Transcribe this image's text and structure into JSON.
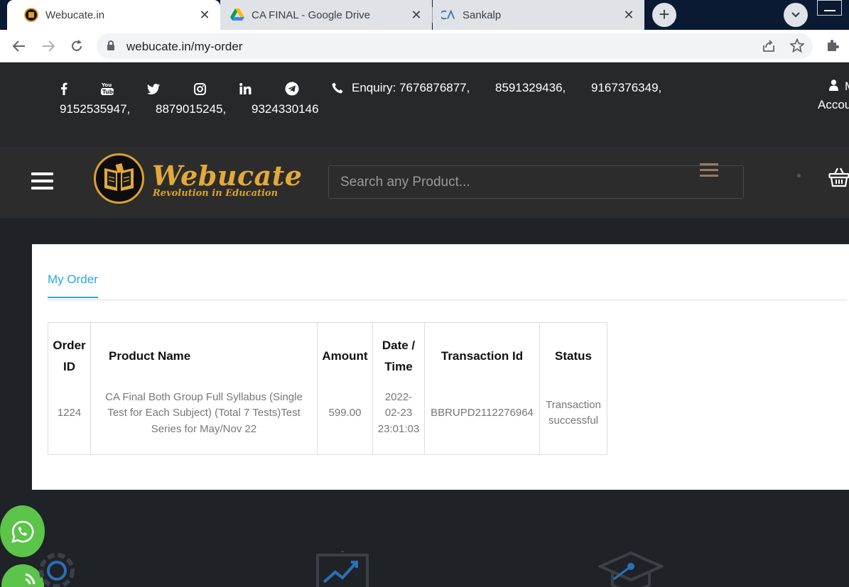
{
  "browser": {
    "tabs": [
      {
        "title": "Webucate.in",
        "active": true
      },
      {
        "title": "CA FINAL - Google Drive",
        "active": false
      },
      {
        "title": "Sankalp",
        "active": false
      }
    ],
    "url": "webucate.in/my-order"
  },
  "topbar": {
    "enquiry_line1": "Enquiry: 7676876877,",
    "phone2": "8591329436,",
    "phone3": "9167376349,",
    "phone4": "9152535947,",
    "phone5": "8879015245,",
    "phone6": "9324330146",
    "account_m": "M",
    "account_label": "Accou",
    "social_icons": [
      "facebook-icon",
      "youtube-icon",
      "twitter-icon",
      "instagram-icon",
      "linkedin-icon",
      "telegram-icon"
    ]
  },
  "header": {
    "logo_text": "Webucate",
    "logo_tagline": "Revolution in Education",
    "search_placeholder": "Search any Product..."
  },
  "orders": {
    "tab_label": "My Order",
    "columns": [
      "Order ID",
      "Product Name",
      "Amount",
      "Date / Time",
      "Transaction Id",
      "Status"
    ],
    "rows": [
      {
        "order_id": "1224",
        "product_name": "CA Final Both Group Full Syllabus (Single Test for Each Subject) (Total 7 Tests)Test Series for May/Nov 22",
        "amount": "599.00",
        "date_time": "2022-02-23 23:01:03",
        "transaction_id": "BBRUPD2112276964",
        "status": "Transaction successful"
      }
    ]
  },
  "colors": {
    "accent": "#2aa7d8",
    "brand_gold": "#e3a93a",
    "topbar_bg": "#26282b",
    "header_bg": "#2c2c2c",
    "page_bg": "#1f2226",
    "whatsapp": "#5cc44a"
  }
}
